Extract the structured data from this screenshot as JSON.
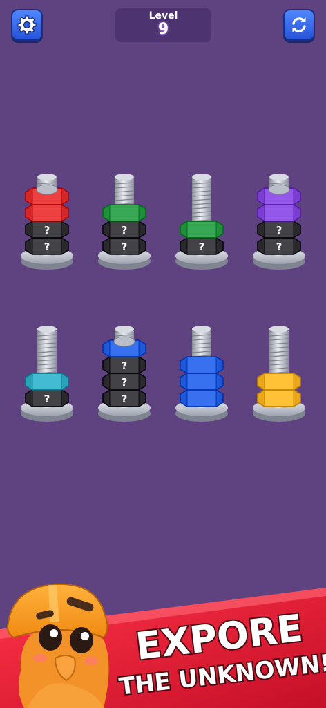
{
  "header": {
    "settings_icon": "gear-icon",
    "restart_icon": "refresh-icon",
    "level_label": "Level",
    "level_number": "9"
  },
  "colors": {
    "background": "#5e4380",
    "button_blue": "#3a6cf0",
    "red": "#d42828",
    "green": "#1f8f3c",
    "purple": "#7a3fd0",
    "cyan": "#2aa2b8",
    "blue": "#1f58d6",
    "yellow": "#e8a81c",
    "hidden": "#2a2a2e"
  },
  "bolts": [
    {
      "nuts": [
        "hidden",
        "hidden",
        "red",
        "red"
      ]
    },
    {
      "nuts": [
        "hidden",
        "hidden",
        "green"
      ]
    },
    {
      "nuts": [
        "hidden",
        "green"
      ]
    },
    {
      "nuts": [
        "hidden",
        "hidden",
        "purple",
        "purple"
      ]
    },
    {
      "nuts": [
        "hidden",
        "cyan"
      ]
    },
    {
      "nuts": [
        "hidden",
        "hidden",
        "hidden",
        "blue"
      ]
    },
    {
      "nuts": [
        "blue",
        "blue",
        "blue"
      ]
    },
    {
      "nuts": [
        "yellow",
        "yellow"
      ]
    }
  ],
  "hidden_mark": "?",
  "banner": {
    "line1": "EXPORE",
    "line2": "THE UNKNOWN!",
    "mascot": "hardhat-nut-mascot"
  }
}
